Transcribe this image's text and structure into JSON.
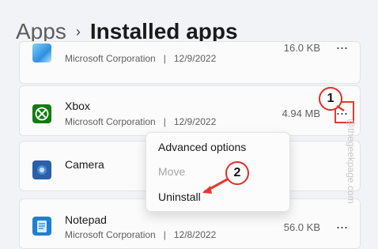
{
  "breadcrumb": {
    "parent": "Apps",
    "separator": "›",
    "current": "Installed apps"
  },
  "apps": [
    {
      "name": "",
      "publisher": "Microsoft Corporation",
      "date": "12/9/2022",
      "size": "16.0 KB",
      "icon": "microsoft-app-icon",
      "icon_color": "#3a9bd9"
    },
    {
      "name": "Xbox",
      "publisher": "Microsoft Corporation",
      "date": "12/9/2022",
      "size": "4.94 MB",
      "icon": "xbox-icon",
      "icon_color": "#107c10"
    },
    {
      "name": "Camera",
      "publisher": "",
      "date": "",
      "size": "",
      "icon": "camera-icon",
      "icon_color": "#2b5fa8"
    },
    {
      "name": "Notepad",
      "publisher": "Microsoft Corporation",
      "date": "12/8/2022",
      "size": "56.0 KB",
      "icon": "notepad-icon",
      "icon_color": "#1f7fd1"
    }
  ],
  "meta_separator": "|",
  "more_glyph": "···",
  "context_menu": {
    "items": [
      "Advanced options",
      "Move",
      "Uninstall"
    ],
    "disabled": [
      "Move"
    ]
  },
  "annotations": {
    "step1": "1",
    "step2": "2",
    "accent": "#d8302b"
  },
  "watermark": "@thegeekpage.com"
}
